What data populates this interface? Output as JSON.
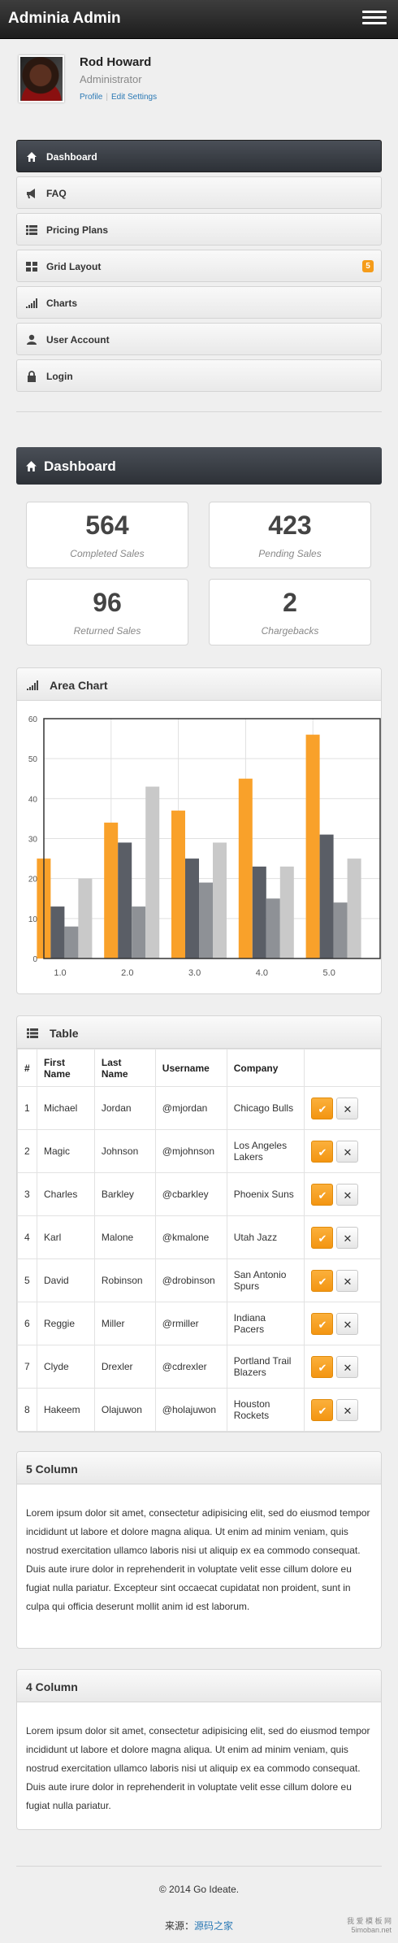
{
  "app": {
    "title": "Adminia Admin"
  },
  "profile": {
    "name": "Rod Howard",
    "role": "Administrator",
    "link_profile": "Profile",
    "link_settings": "Edit Settings"
  },
  "nav": [
    {
      "label": "Dashboard",
      "icon": "home-icon",
      "active": true
    },
    {
      "label": "FAQ",
      "icon": "bullhorn-icon"
    },
    {
      "label": "Pricing Plans",
      "icon": "list-icon"
    },
    {
      "label": "Grid Layout",
      "icon": "grid-icon",
      "badge": "5"
    },
    {
      "label": "Charts",
      "icon": "signal-icon"
    },
    {
      "label": "User Account",
      "icon": "user-icon"
    },
    {
      "label": "Login",
      "icon": "lock-icon"
    }
  ],
  "dashboard": {
    "title": "Dashboard",
    "stats": [
      {
        "value": "564",
        "label": "Completed Sales"
      },
      {
        "value": "423",
        "label": "Pending Sales"
      },
      {
        "value": "96",
        "label": "Returned Sales"
      },
      {
        "value": "2",
        "label": "Chargebacks"
      }
    ]
  },
  "area_chart": {
    "title": "Area Chart"
  },
  "chart_data": {
    "type": "bar",
    "title": "",
    "categories": [
      "1.0",
      "2.0",
      "3.0",
      "4.0",
      "5.0"
    ],
    "series": [
      {
        "values": [
          25,
          34,
          37,
          45,
          56
        ],
        "color": "#f9a12a"
      },
      {
        "values": [
          13,
          29,
          25,
          23,
          31
        ],
        "color": "#5a5e66"
      },
      {
        "values": [
          8,
          13,
          19,
          15,
          14
        ],
        "color": "#8e9196"
      },
      {
        "values": [
          20,
          43,
          29,
          23,
          25
        ],
        "color": "#c9c9c9"
      }
    ],
    "ylim": [
      0,
      60
    ],
    "yticks": [
      "0",
      "10",
      "20",
      "30",
      "40",
      "50",
      "60"
    ],
    "grid": true
  },
  "table": {
    "title": "Table",
    "columns": [
      "#",
      "First Name",
      "Last Name",
      "Username",
      "Company"
    ],
    "rows": [
      [
        "1",
        "Michael",
        "Jordan",
        "@mjordan",
        "Chicago Bulls"
      ],
      [
        "2",
        "Magic",
        "Johnson",
        "@mjohnson",
        "Los Angeles Lakers"
      ],
      [
        "3",
        "Charles",
        "Barkley",
        "@cbarkley",
        "Phoenix Suns"
      ],
      [
        "4",
        "Karl",
        "Malone",
        "@kmalone",
        "Utah Jazz"
      ],
      [
        "5",
        "David",
        "Robinson",
        "@drobinson",
        "San Antonio Spurs"
      ],
      [
        "6",
        "Reggie",
        "Miller",
        "@rmiller",
        "Indiana Pacers"
      ],
      [
        "7",
        "Clyde",
        "Drexler",
        "@cdrexler",
        "Portland Trail Blazers"
      ],
      [
        "8",
        "Hakeem",
        "Olajuwon",
        "@holajuwon",
        "Houston Rockets"
      ]
    ],
    "ok_glyph": "✔",
    "close_glyph": "✕"
  },
  "five_column": {
    "title": "5 Column",
    "text": "Lorem ipsum dolor sit amet, consectetur adipisicing elit, sed do eiusmod tempor incididunt ut labore et dolore magna aliqua. Ut enim ad minim veniam, quis nostrud exercitation ullamco laboris nisi ut aliquip ex ea commodo consequat. Duis aute irure dolor in reprehenderit in voluptate velit esse cillum dolore eu fugiat nulla pariatur. Excepteur sint occaecat cupidatat non proident, sunt in culpa qui officia deserunt mollit anim id est laborum."
  },
  "four_column": {
    "title": "4 Column",
    "text": "Lorem ipsum dolor sit amet, consectetur adipisicing elit, sed do eiusmod tempor incididunt ut labore et dolore magna aliqua. Ut enim ad minim veniam, quis nostrud exercitation ullamco laboris nisi ut aliquip ex ea commodo consequat. Duis aute irure dolor in reprehenderit in voluptate velit esse cillum dolore eu fugiat nulla pariatur."
  },
  "footer": {
    "copyright": "© 2014 Go Ideate."
  },
  "source": {
    "label": "来源：",
    "link": "源码之家"
  },
  "watermark": {
    "text": "我 爱 模 板 网 5imoban.net"
  }
}
